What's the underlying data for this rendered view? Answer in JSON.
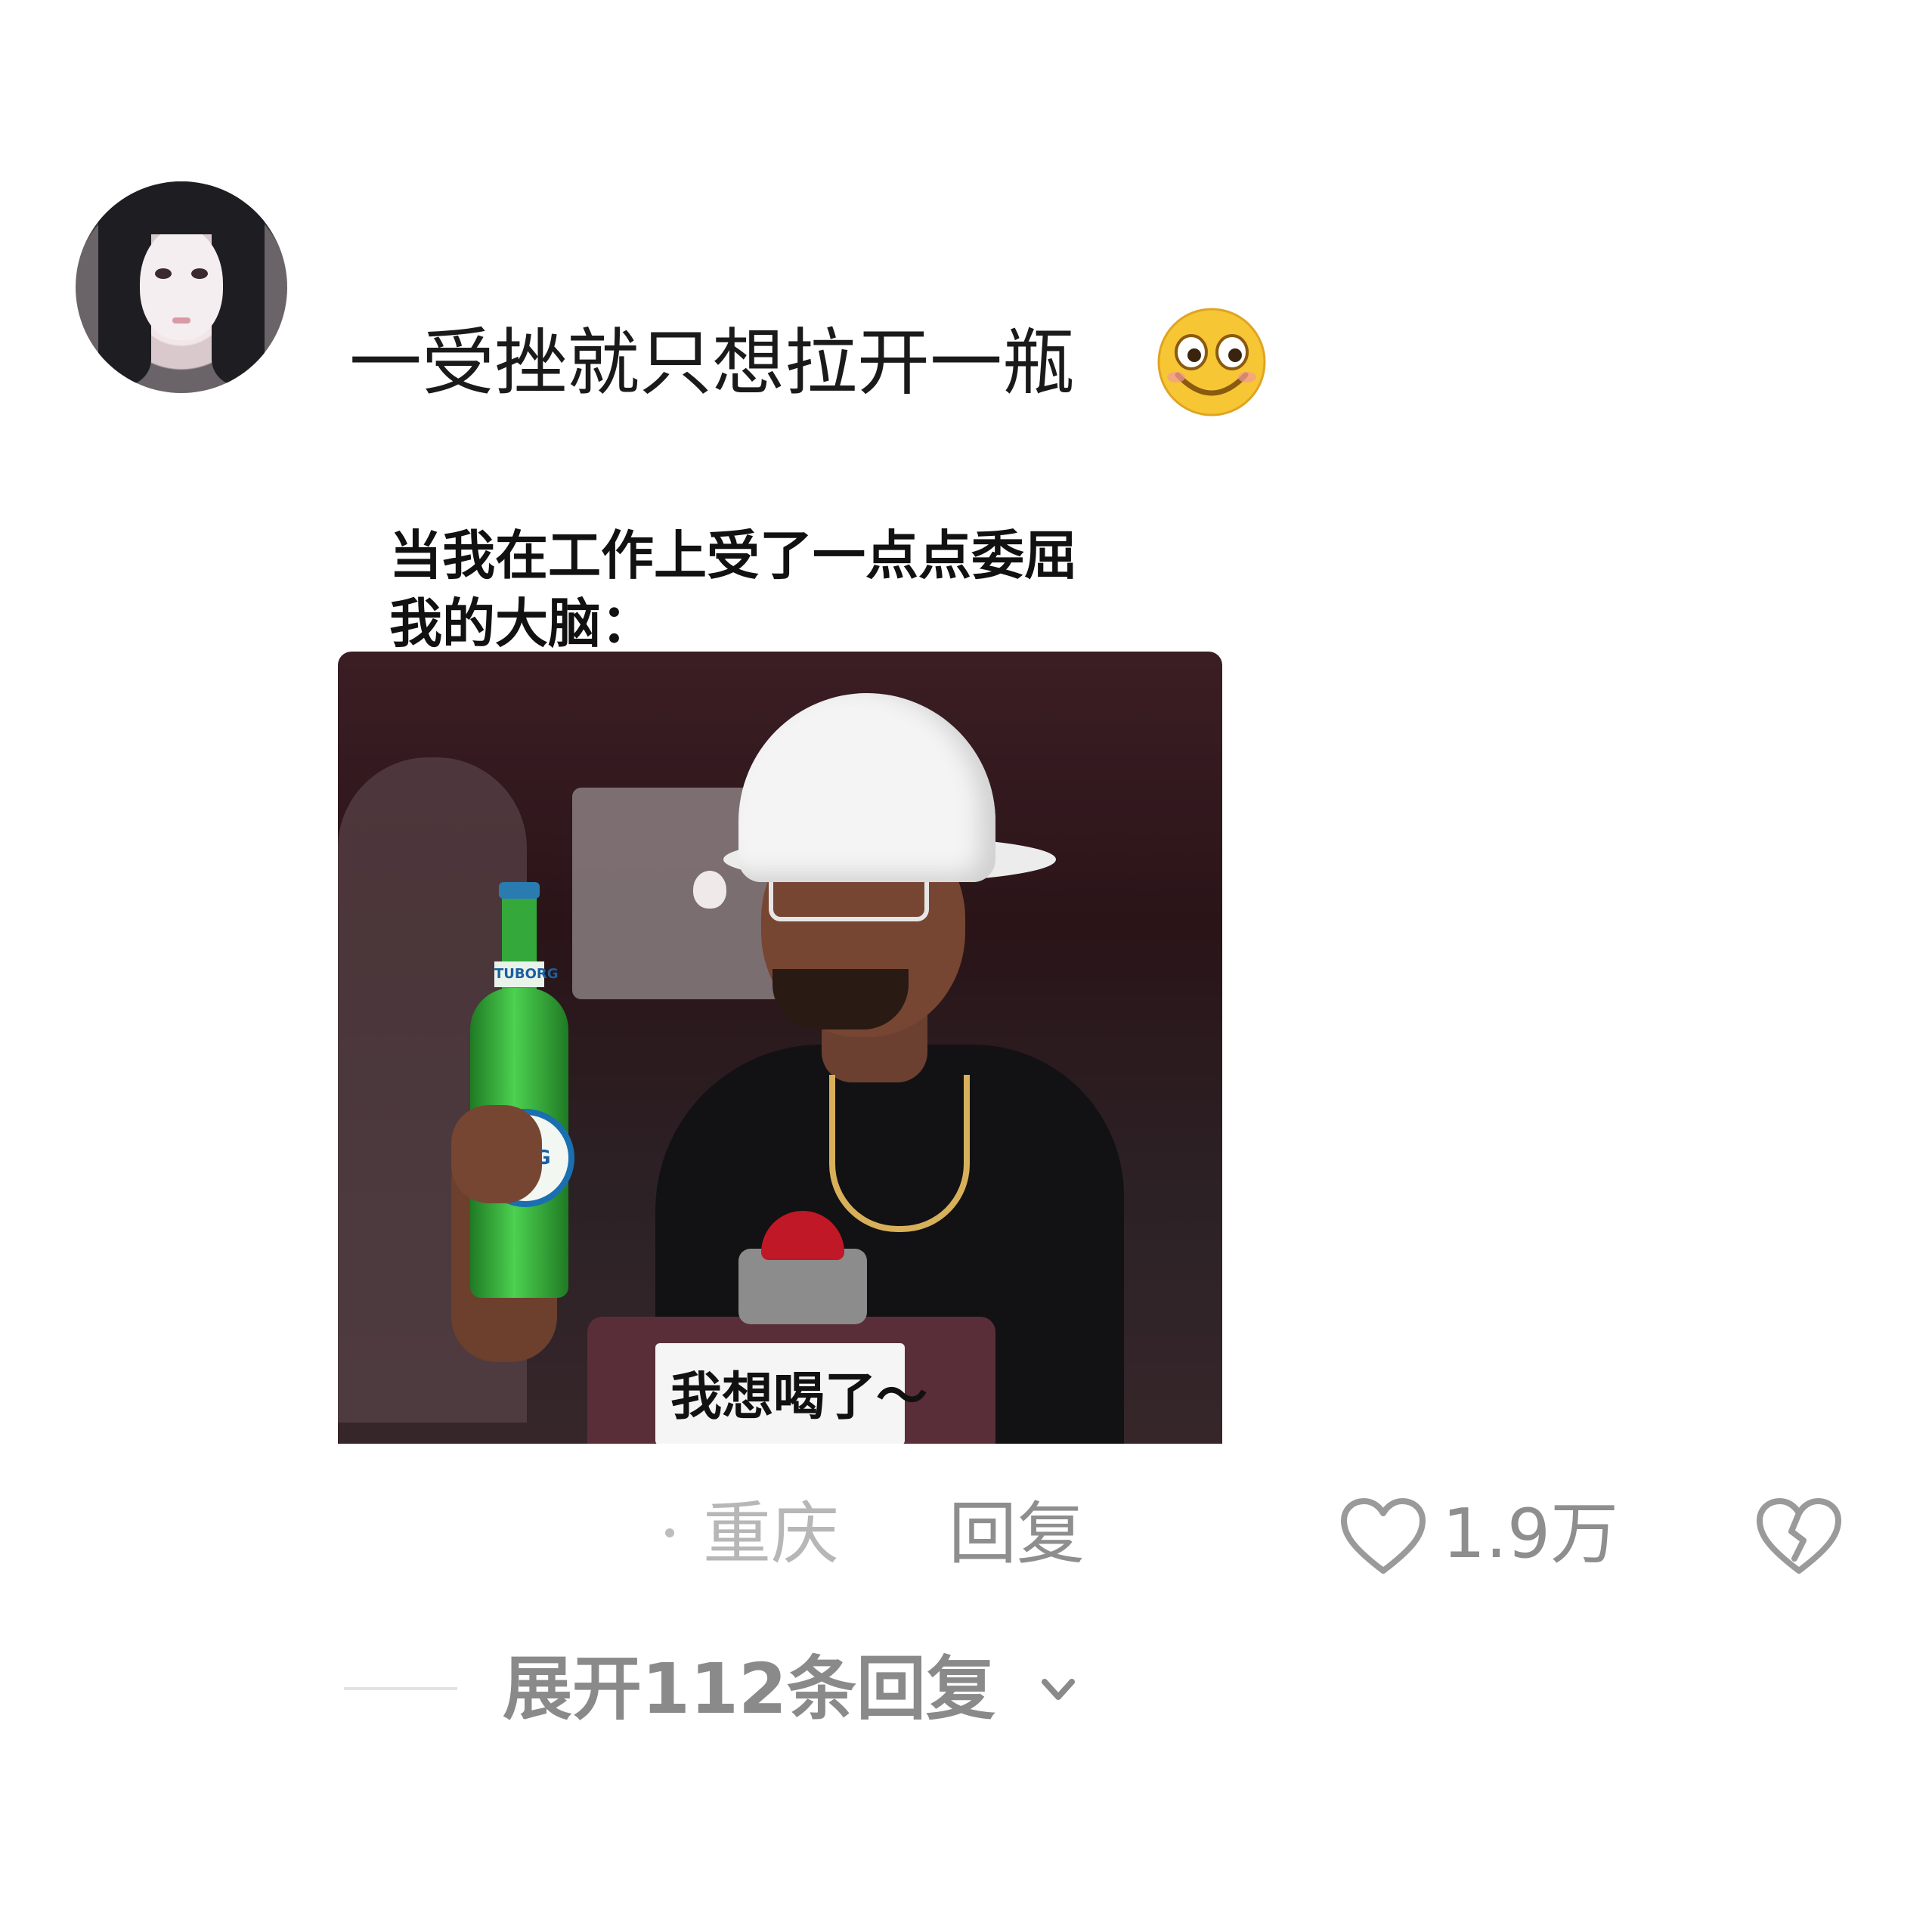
{
  "comment": {
    "text": "一受挫就只想拉开一瓶",
    "emoji": "smiling-face-emoji"
  },
  "meme": {
    "caption_line1": "当我在工作上受了一点点委屈",
    "caption_line2": "我的大脑：",
    "podium_label": "我想喝了～",
    "bottle_brand": "TUBORG",
    "bottle_label": "BORG"
  },
  "meta": {
    "location": "重庆",
    "reply_label": "回复",
    "like_count": "1.9万"
  },
  "expand": {
    "label": "展开112条回复"
  },
  "colors": {
    "text_primary": "#1a1a1a",
    "text_secondary": "#8e8e8e",
    "text_muted": "#b7b7b7"
  }
}
